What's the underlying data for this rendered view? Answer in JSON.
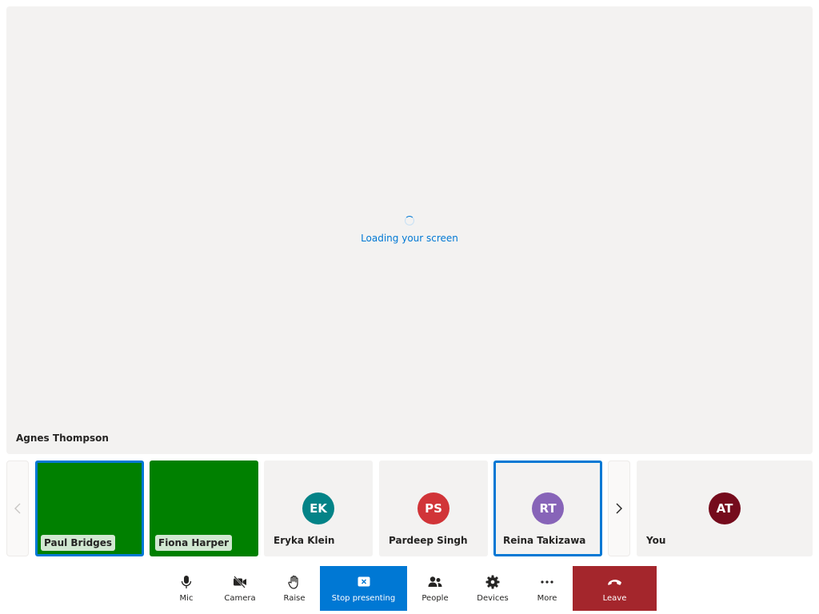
{
  "stage": {
    "loading_text": "Loading your screen",
    "presenter_name": "Agnes Thompson"
  },
  "gallery": {
    "tiles": [
      {
        "name": "Paul Bridges",
        "initials": "",
        "video": true,
        "active": true,
        "avatar_color": ""
      },
      {
        "name": "Fiona Harper",
        "initials": "",
        "video": true,
        "active": false,
        "avatar_color": ""
      },
      {
        "name": "Eryka Klein",
        "initials": "EK",
        "video": false,
        "active": false,
        "avatar_color": "#038387"
      },
      {
        "name": "Pardeep Singh",
        "initials": "PS",
        "video": false,
        "active": false,
        "avatar_color": "#d13438"
      },
      {
        "name": "Reina Takizawa",
        "initials": "RT",
        "video": false,
        "active": true,
        "avatar_color": "#8764b8"
      }
    ],
    "self": {
      "name": "You",
      "initials": "AT",
      "avatar_color": "#750b1c"
    }
  },
  "controls": {
    "mic": {
      "label": "Mic",
      "icon": "mic-icon"
    },
    "camera": {
      "label": "Camera",
      "icon": "camera-off-icon"
    },
    "raise": {
      "label": "Raise",
      "icon": "hand-icon"
    },
    "stop_presenting": {
      "label": "Stop presenting",
      "icon": "stop-share-icon"
    },
    "people": {
      "label": "People",
      "icon": "people-icon"
    },
    "devices": {
      "label": "Devices",
      "icon": "gear-icon"
    },
    "more": {
      "label": "More",
      "icon": "more-icon"
    },
    "leave": {
      "label": "Leave",
      "icon": "hang-up-icon"
    }
  },
  "colors": {
    "accent": "#0078d4",
    "leave": "#a4262c",
    "video_tile": "#008000",
    "stage_bg": "#f3f2f1"
  }
}
